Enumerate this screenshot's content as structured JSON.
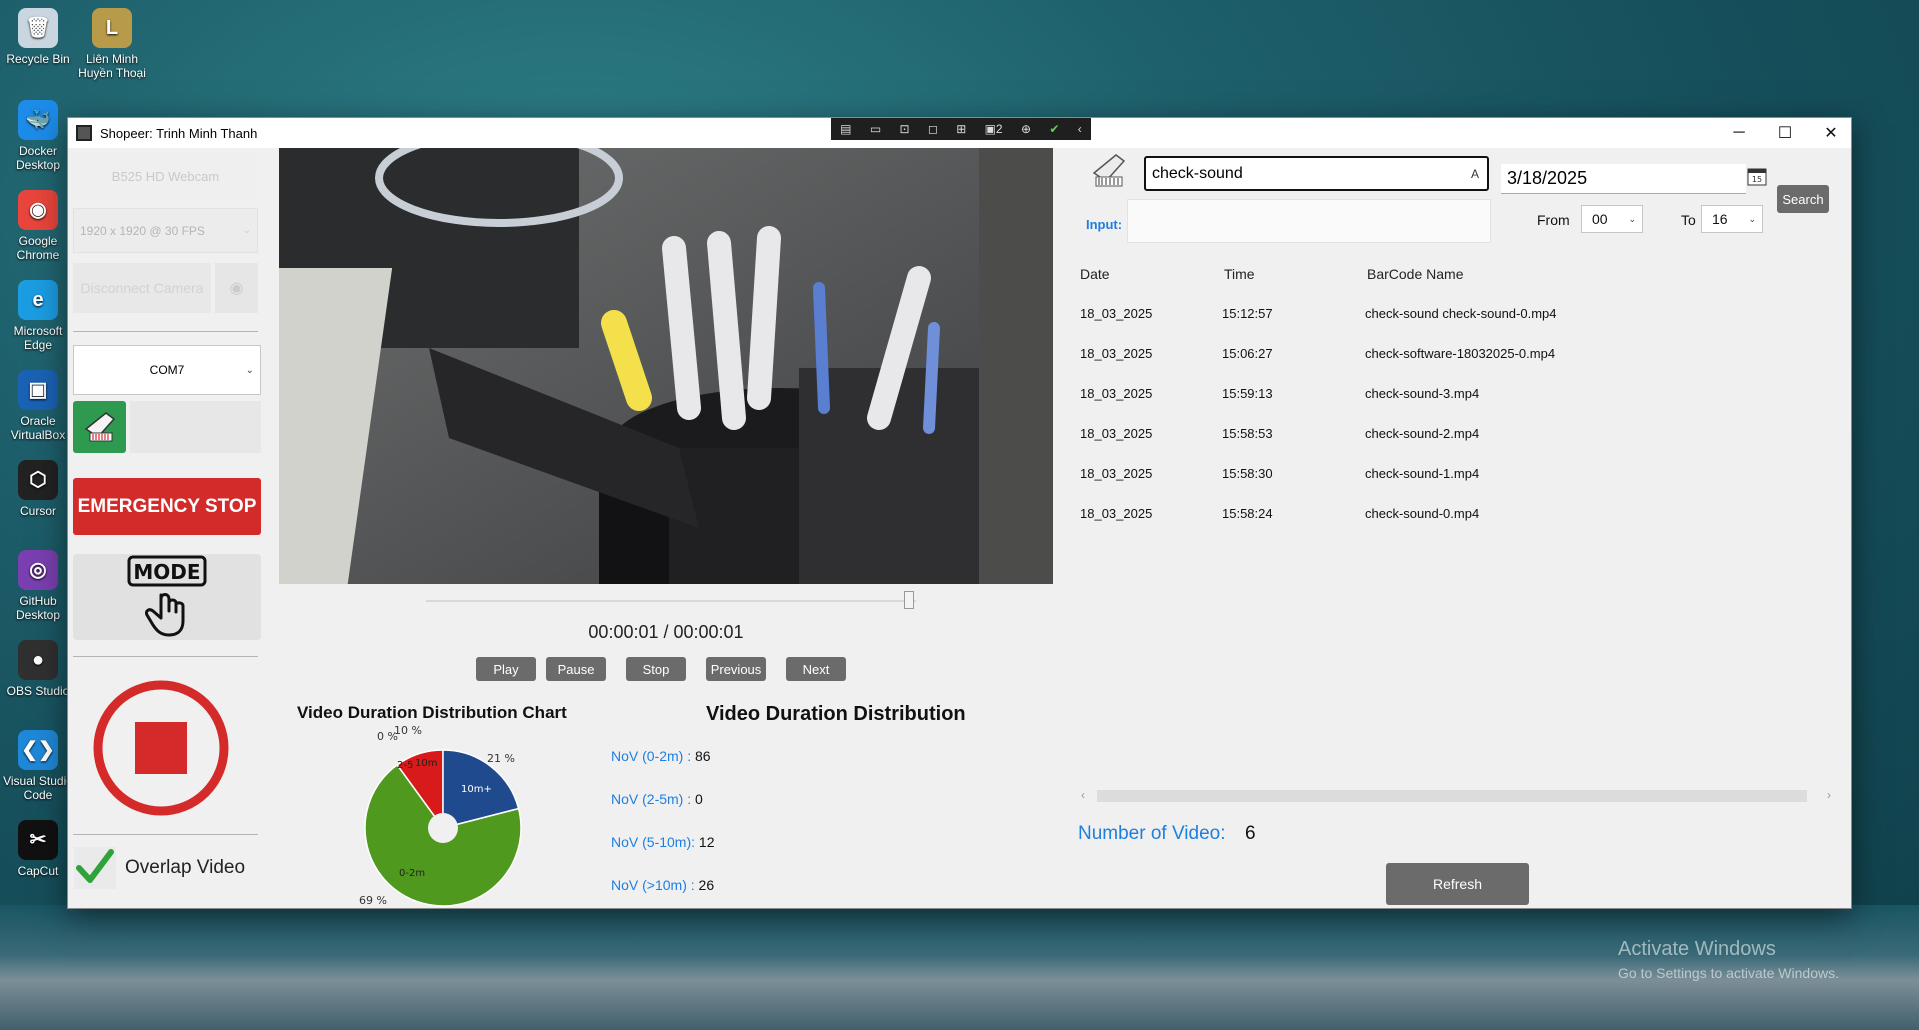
{
  "desktop": {
    "icons": [
      {
        "label": "Recycle Bin",
        "glyph": "🗑",
        "color": "#c9d6e0"
      },
      {
        "label": "Liên Minh Huyền Thoại",
        "glyph": "L",
        "color": "#b89b4a"
      },
      {
        "label": "Docker Desktop",
        "glyph": "🐳",
        "color": "#1d8be8"
      },
      {
        "label": "Google Chrome",
        "glyph": "◉",
        "color": "#e8453c"
      },
      {
        "label": "Microsoft Edge",
        "glyph": "e",
        "color": "#1b9de2"
      },
      {
        "label": "Oracle VirtualBox",
        "glyph": "▣",
        "color": "#1a62b4"
      },
      {
        "label": "Cursor",
        "glyph": "⬡",
        "color": "#222"
      },
      {
        "label": "GitHub Desktop",
        "glyph": "◎",
        "color": "#7a3fb0"
      },
      {
        "label": "OBS Studio",
        "glyph": "●",
        "color": "#303030"
      },
      {
        "label": "Visual Studio Code",
        "glyph": "❮❯",
        "color": "#1f88d8"
      },
      {
        "label": "CapCut",
        "glyph": "✂",
        "color": "#111"
      }
    ],
    "activate_title": "Activate Windows",
    "activate_sub": "Go to Settings to activate Windows."
  },
  "window": {
    "title": "Shopeer: Trinh Minh Thanh",
    "minimize": "─",
    "maximize": "☐",
    "close": "✕",
    "rc_badge": "2"
  },
  "left": {
    "camera_name": "B525 HD Webcam",
    "resolution": "1920 x 1920 @ 30 FPS",
    "disconnect_label": "Disconnect Camera",
    "com_port": "COM7",
    "emergency_label": "EMERGENCY STOP",
    "mode_label": "MODE",
    "overlap_label": "Overlap Video"
  },
  "player": {
    "timecode": "00:00:01 / 00:00:01",
    "progress_fraction": 1.0,
    "buttons": {
      "play": "Play",
      "pause": "Pause",
      "stop": "Stop",
      "previous": "Previous",
      "next": "Next"
    }
  },
  "stats": {
    "chart_title": "Video Duration Distribution Chart",
    "dist_title": "Video Duration Distribution",
    "rows": [
      {
        "label": "NoV (0-2m) :",
        "value": "86"
      },
      {
        "label": "NoV (2-5m) :",
        "value": "0"
      },
      {
        "label": "NoV (5-10m):",
        "value": "12"
      },
      {
        "label": "NoV (>10m) :",
        "value": "26"
      }
    ]
  },
  "chart_data": {
    "type": "pie",
    "title": "Video Duration Distribution Chart",
    "slices": [
      {
        "label": "0-2m",
        "value": 69,
        "color": "#4f9a1e",
        "pct_label": "69 %"
      },
      {
        "label": "2-5m",
        "value": 0,
        "color": "#c7c7c7",
        "pct_label": "0 %"
      },
      {
        "label": "5-10m",
        "value": 10,
        "color": "#d81a1a",
        "pct_label": "10 %"
      },
      {
        "label": "10m+",
        "value": 21,
        "color": "#1f4a8e",
        "pct_label": "21 %"
      }
    ],
    "inner_labels": [
      "0-2m",
      "2-5",
      "10m",
      "10m+"
    ],
    "donut": true
  },
  "search": {
    "barcode_value": "check-sound",
    "clear_glyph": "A",
    "input_label": "Input:",
    "input_value": "",
    "date": "3/18/2025",
    "search_label": "Search",
    "from_label": "From",
    "from_value": "00",
    "to_label": "To",
    "to_value": "16"
  },
  "table": {
    "headers": [
      "Date",
      "Time",
      "BarCode Name"
    ],
    "rows": [
      [
        "18_03_2025",
        "15:12:57",
        "check-sound check-sound-0.mp4"
      ],
      [
        "18_03_2025",
        "15:06:27",
        "check-software-18032025-0.mp4"
      ],
      [
        "18_03_2025",
        "15:59:13",
        "check-sound-3.mp4"
      ],
      [
        "18_03_2025",
        "15:58:53",
        "check-sound-2.mp4"
      ],
      [
        "18_03_2025",
        "15:58:30",
        "check-sound-1.mp4"
      ],
      [
        "18_03_2025",
        "15:58:24",
        "check-sound-0.mp4"
      ]
    ]
  },
  "footer": {
    "count_label": "Number of Video:",
    "count_value": "6",
    "refresh_label": "Refresh"
  },
  "colors": {
    "accent_blue": "#1e7fe0",
    "emergency_red": "#d32a2a",
    "button_gray": "#6b6b6b"
  }
}
